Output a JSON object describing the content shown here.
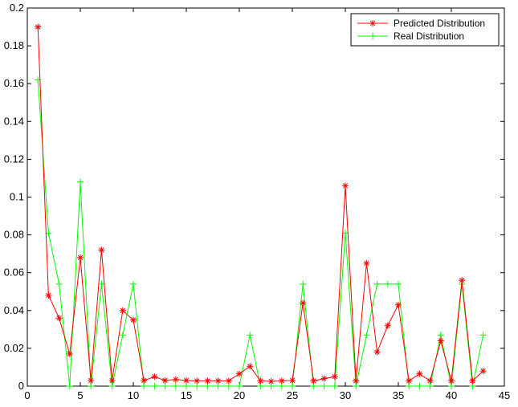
{
  "chart_data": {
    "type": "line",
    "title": "",
    "xlabel": "",
    "ylabel": "",
    "xlim": [
      0,
      45
    ],
    "ylim": [
      0,
      0.2
    ],
    "xticks": [
      0,
      5,
      10,
      15,
      20,
      25,
      30,
      35,
      40,
      45
    ],
    "yticks": [
      0,
      0.02,
      0.04,
      0.06,
      0.08,
      0.1,
      0.12,
      0.14,
      0.16,
      0.18,
      0.2
    ],
    "xtick_labels": [
      "0",
      "5",
      "10",
      "15",
      "20",
      "25",
      "30",
      "35",
      "40",
      "45"
    ],
    "ytick_labels": [
      "0",
      "0.02",
      "0.04",
      "0.06",
      "0.08",
      "0.1",
      "0.12",
      "0.14",
      "0.16",
      "0.18",
      "0.2"
    ],
    "grid": false,
    "legend_position": "top-right",
    "x": [
      1,
      2,
      3,
      4,
      5,
      6,
      7,
      8,
      9,
      10,
      11,
      12,
      13,
      14,
      15,
      16,
      17,
      18,
      19,
      20,
      21,
      22,
      23,
      24,
      25,
      26,
      27,
      28,
      29,
      30,
      31,
      32,
      33,
      34,
      35,
      36,
      37,
      38,
      39,
      40,
      41,
      42,
      43
    ],
    "series": [
      {
        "name": "Predicted Distribution",
        "color": "#ff0000",
        "marker": "asterisk",
        "values": [
          0.19,
          0.048,
          0.036,
          0.017,
          0.068,
          0.003,
          0.072,
          0.003,
          0.04,
          0.035,
          0.003,
          0.005,
          0.003,
          0.0035,
          0.003,
          0.0028,
          0.0028,
          0.0028,
          0.0028,
          0.0065,
          0.0105,
          0.0028,
          0.0025,
          0.0028,
          0.003,
          0.044,
          0.0028,
          0.004,
          0.005,
          0.106,
          0.0028,
          0.065,
          0.018,
          0.032,
          0.043,
          0.0028,
          0.0065,
          0.0028,
          0.024,
          0.0028,
          0.056,
          0.0028,
          0.008
        ]
      },
      {
        "name": "Real Distribution",
        "color": "#00ff00",
        "marker": "plus",
        "values": [
          0.162,
          0.081,
          0.054,
          0,
          0.108,
          0,
          0.054,
          0,
          0.027,
          0.054,
          0,
          0,
          0,
          0,
          0,
          0,
          0,
          0,
          0,
          0,
          0.027,
          0,
          0,
          0,
          0,
          0.054,
          0,
          0,
          0,
          0.081,
          0,
          0.027,
          0.054,
          0.054,
          0.054,
          0,
          0,
          0,
          0.027,
          0,
          0.054,
          0,
          0.027
        ]
      }
    ]
  }
}
